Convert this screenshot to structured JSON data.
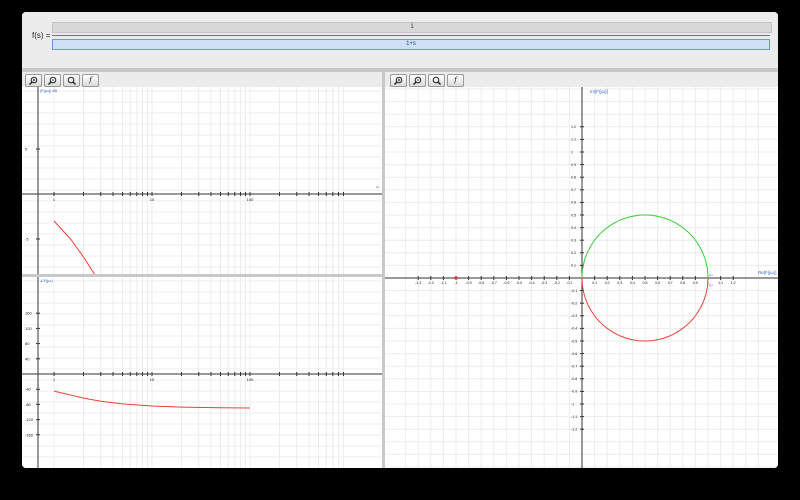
{
  "function_entry": {
    "label": "f(s) =",
    "numerator": "1",
    "denominator": "1+s"
  },
  "toolbar_left": {
    "buttons": [
      {
        "name": "zoom-in-button",
        "icon": "zoom-in-icon",
        "label": ""
      },
      {
        "name": "zoom-out-button",
        "icon": "zoom-out-icon",
        "label": ""
      },
      {
        "name": "zoom-fit-button",
        "icon": "magnifier-icon",
        "label": ""
      },
      {
        "name": "function-button",
        "icon": "function-icon",
        "label": "f"
      }
    ]
  },
  "toolbar_right": {
    "buttons": [
      {
        "name": "zoom-in-button",
        "icon": "zoom-in-icon",
        "label": ""
      },
      {
        "name": "zoom-out-button",
        "icon": "zoom-out-icon",
        "label": ""
      },
      {
        "name": "zoom-fit-button",
        "icon": "magnifier-icon",
        "label": ""
      },
      {
        "name": "function-button",
        "icon": "function-icon",
        "label": "f"
      }
    ]
  },
  "chart_data": [
    {
      "type": "line",
      "name": "bode-magnitude",
      "ylabel": "|F(jω)| dB",
      "xlabel": "ω",
      "xscale": "log",
      "xlim": [
        0.5,
        150
      ],
      "ylim": [
        -12,
        12
      ],
      "x_ticks": [
        {
          "value": 1,
          "label": "1"
        },
        {
          "value": 10,
          "label": "10"
        },
        {
          "value": 100,
          "label": "100"
        }
      ],
      "y_ticks": [
        {
          "value": 5,
          "label": "5"
        },
        {
          "value": -5,
          "label": "-5"
        },
        {
          "value": -10,
          "label": "-10"
        }
      ],
      "color": "#e8413a",
      "series": [
        {
          "x": [
            1,
            1.5,
            2,
            3,
            4,
            4.95
          ],
          "y": [
            -3.0,
            -5.1,
            -7.0,
            -10.0,
            -12.3,
            -14.0
          ]
        }
      ]
    },
    {
      "type": "line",
      "name": "bode-phase",
      "ylabel": "∠F(jω)",
      "xscale": "log",
      "xlim": [
        0.5,
        150
      ],
      "ylim": [
        -180,
        180
      ],
      "x_ticks": [
        {
          "value": 1,
          "label": "1"
        },
        {
          "value": 10,
          "label": "10"
        },
        {
          "value": 100,
          "label": "100"
        }
      ],
      "y_ticks": [
        {
          "value": 160,
          "label": "160"
        },
        {
          "value": 120,
          "label": "120"
        },
        {
          "value": 80,
          "label": "80"
        },
        {
          "value": 40,
          "label": "40"
        },
        {
          "value": -40,
          "label": "-40"
        },
        {
          "value": -80,
          "label": "-80"
        },
        {
          "value": -120,
          "label": "-120"
        },
        {
          "value": -160,
          "label": "-160"
        }
      ],
      "color": "#e8413a",
      "series": [
        {
          "x": [
            1,
            2,
            3,
            5,
            10,
            20,
            50,
            100
          ],
          "y": [
            -45,
            -63.4,
            -71.6,
            -78.7,
            -84.3,
            -87.1,
            -88.9,
            -89.4
          ]
        }
      ]
    },
    {
      "type": "line",
      "name": "nyquist",
      "xlabel": "Re[F(jω)]",
      "ylabel": "Im[F(jω)]",
      "xlim": [
        -1.33,
        1.3
      ],
      "ylim": [
        -1.2,
        1.26
      ],
      "x_tick_labels": [
        "-1.3",
        "-1.2",
        "-1.1",
        "-1",
        "-0.9",
        "-0.8",
        "-0.7",
        "-0.6",
        "-0.5",
        "-0.4",
        "-0.3",
        "-0.2",
        "-0.1",
        "0",
        "0.1",
        "0.2",
        "0.3",
        "0.4",
        "0.5",
        "0.6",
        "0.7",
        "0.8",
        "0.9",
        "1",
        "1.1",
        "1.2"
      ],
      "y_tick_labels": [
        "1.2",
        "1.1",
        "1",
        "0.9",
        "0.8",
        "0.7",
        "0.6",
        "0.5",
        "0.4",
        "0.3",
        "0.2",
        "0.1",
        "-0.1",
        "-0.2",
        "-0.3",
        "-0.4",
        "-0.5",
        "-0.6",
        "-0.7",
        "-0.8",
        "-0.9",
        "-1",
        "-1.1",
        "-1.2"
      ],
      "critical_point": {
        "x": -1,
        "y": 0,
        "color": "#e03020"
      },
      "center": 0.5,
      "radius": 0.5,
      "series": [
        {
          "part": "negative-frequency",
          "color": "#3ec93e"
        },
        {
          "part": "positive-frequency",
          "color": "#e8413a"
        }
      ],
      "endpoint_labels": [
        {
          "x": 1,
          "y": 0.02,
          "text": "0+"
        },
        {
          "x": 1,
          "y": -0.06,
          "text": "0+"
        }
      ]
    }
  ]
}
